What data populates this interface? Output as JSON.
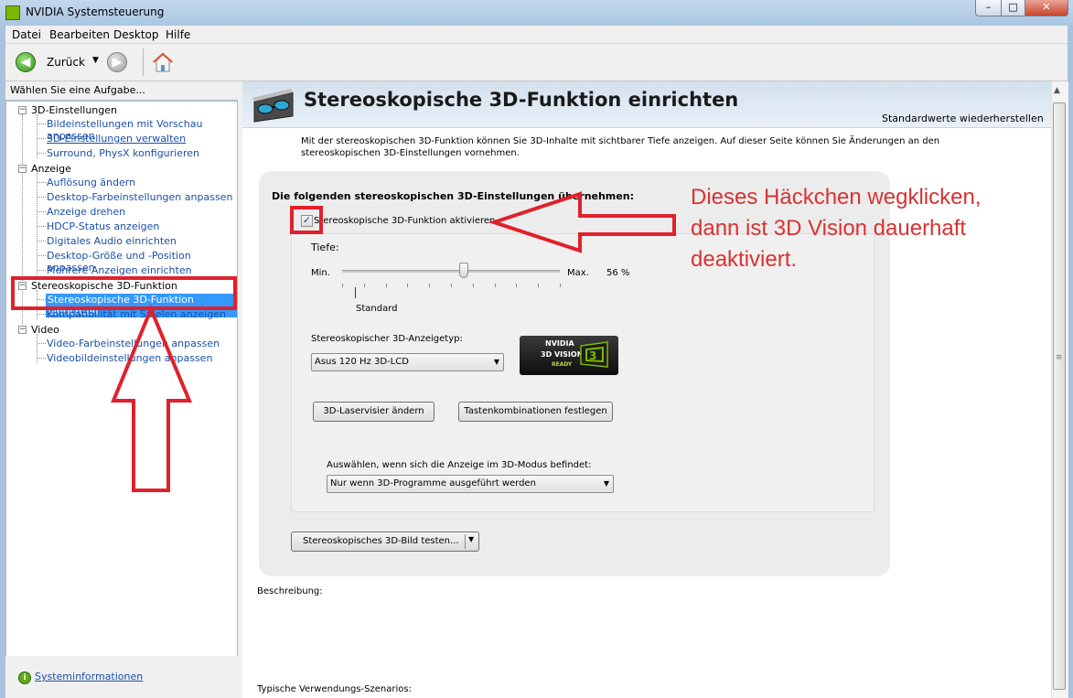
{
  "window": {
    "title": "NVIDIA Systemsteuerung"
  },
  "menu": [
    "Datei",
    "Bearbeiten",
    "Desktop",
    "Hilfe"
  ],
  "toolbar": {
    "back_label": "Zurück"
  },
  "sidebar": {
    "header": "Wählen Sie eine Aufgabe...",
    "categories": [
      {
        "label": "3D-Einstellungen",
        "items": [
          "Bildeinstellungen mit Vorschau anpassen",
          "3D-Einstellungen verwalten",
          "Surround, PhysX konfigurieren"
        ]
      },
      {
        "label": "Anzeige",
        "items": [
          "Auflösung ändern",
          "Desktop-Farbeinstellungen anpassen",
          "Anzeige drehen",
          "HDCP-Status anzeigen",
          "Digitales Audio einrichten",
          "Desktop-Größe und -Position anpassen",
          "Mehrere Anzeigen einrichten"
        ]
      },
      {
        "label": "Stereoskopische 3D-Funktion",
        "items": [
          "Stereoskopische 3D-Funktion einrichten",
          "Kompatibilität mit Spielen anzeigen"
        ]
      },
      {
        "label": "Video",
        "items": [
          "Video-Farbeinstellungen anpassen",
          "Videobildeinstellungen anpassen"
        ]
      }
    ],
    "footer_link": "Systeminformationen"
  },
  "main": {
    "title": "Stereoskopische 3D-Funktion einrichten",
    "restore_defaults": "Standardwerte wiederherstellen",
    "description": "Mit der stereoskopischen 3D-Funktion können Sie 3D-Inhalte mit sichtbarer Tiefe anzeigen. Auf dieser Seite können Sie Änderungen an den stereoskopischen 3D-Einstellungen vornehmen.",
    "settings_heading": "Die folgenden stereoskopischen 3D-Einstellungen übernehmen:",
    "enable_label": "Stereoskopische 3D-Funktion aktivieren",
    "enable_checked": true,
    "depth_label": "Tiefe:",
    "min_label": "Min.",
    "max_label": "Max.",
    "depth_value": "56  %",
    "depth_percent": 56,
    "standard_label": "Standard",
    "display_type_label": "Stereoskopischer 3D-Anzeigetyp:",
    "display_type_value": "Asus 120 Hz 3D-LCD",
    "vision_badge": {
      "brand": "NVIDIA",
      "name": "3D VISION",
      "status": "READY"
    },
    "laser_button": "3D-Laservisier ändern",
    "shortcut_button": "Tastenkombinationen festlegen",
    "mode_label": "Auswählen, wenn sich die Anzeige im 3D-Modus befindet:",
    "mode_value": "Nur wenn 3D-Programme ausgeführt werden",
    "test_button": "Stereoskopisches 3D-Bild testen...",
    "desc_label": "Beschreibung:",
    "scenario_label": "Typische Verwendungs-Szenarios:"
  },
  "annotation": {
    "lines": [
      "Dieses Häckchen wegklicken,",
      "dann ist 3D Vision dauerhaft",
      "deaktiviert."
    ],
    "color": "#e0212b"
  },
  "colors": {
    "selection": "#3399ff",
    "link": "#1b4fa8",
    "titlebar": "#aac6e2"
  }
}
